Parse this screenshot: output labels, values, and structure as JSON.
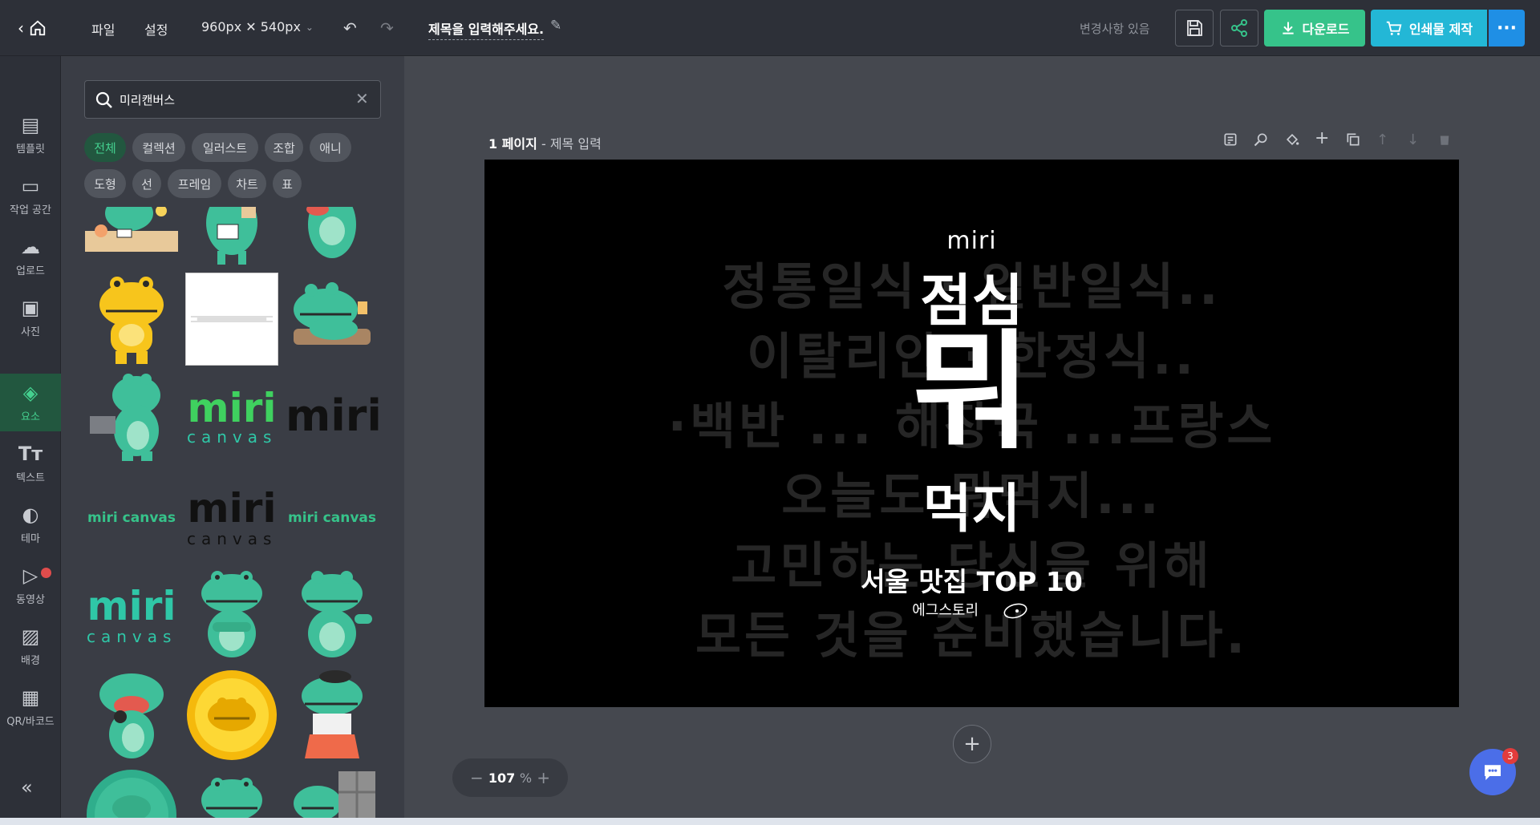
{
  "topbar": {
    "menu_file": "파일",
    "menu_settings": "설정",
    "canvas_size": "960px ✕ 540px",
    "doc_title": "제목을 입력해주세요.",
    "changes_status": "변경사항 있음",
    "download_label": "다운로드",
    "print_label": "인쇄물 제작"
  },
  "rail": {
    "items": [
      {
        "label": "템플릿",
        "icon": "template-icon"
      },
      {
        "label": "작업 공간",
        "icon": "workspace-icon"
      },
      {
        "label": "업로드",
        "icon": "upload-icon"
      },
      {
        "label": "사진",
        "icon": "photo-icon"
      },
      {
        "label": "요소",
        "icon": "elements-icon",
        "active": true
      },
      {
        "label": "텍스트",
        "icon": "text-icon"
      },
      {
        "label": "테마",
        "icon": "theme-icon"
      },
      {
        "label": "동영상",
        "icon": "video-icon"
      },
      {
        "label": "배경",
        "icon": "background-icon"
      },
      {
        "label": "QR/바코드",
        "icon": "qr-icon"
      }
    ]
  },
  "panel": {
    "search_value": "미리캔버스",
    "chips": [
      {
        "label": "전체",
        "active": true
      },
      {
        "label": "컬렉션"
      },
      {
        "label": "일러스트"
      },
      {
        "label": "조합"
      },
      {
        "label": "애니"
      },
      {
        "label": "도형"
      },
      {
        "label": "선"
      },
      {
        "label": "프레임"
      },
      {
        "label": "차트"
      },
      {
        "label": "표"
      }
    ],
    "logo_text_1": "miri",
    "logo_text_2": "canvas",
    "logo_inline": "miri canvas"
  },
  "page": {
    "number_label": "1 페이지",
    "title_placeholder": "제목 입력"
  },
  "canvas": {
    "bg_lines": [
      "정통일식 · 일반일식..",
      "이탈리안 · 한정식..",
      "·백반 ... 해장국 ...프랑스",
      "오늘도 뭐먹지...",
      "고민하는 당신을 위해",
      "모든 것을 준비했습니다."
    ],
    "brand": "miri",
    "headline_top": "점심",
    "headline_main": "뭐",
    "headline_bottom": "먹지",
    "subtitle": "서울 맛집 TOP 10",
    "signature": "에그스토리"
  },
  "zoom": {
    "value": "107",
    "unit": "%"
  },
  "chat": {
    "badge": "3"
  }
}
